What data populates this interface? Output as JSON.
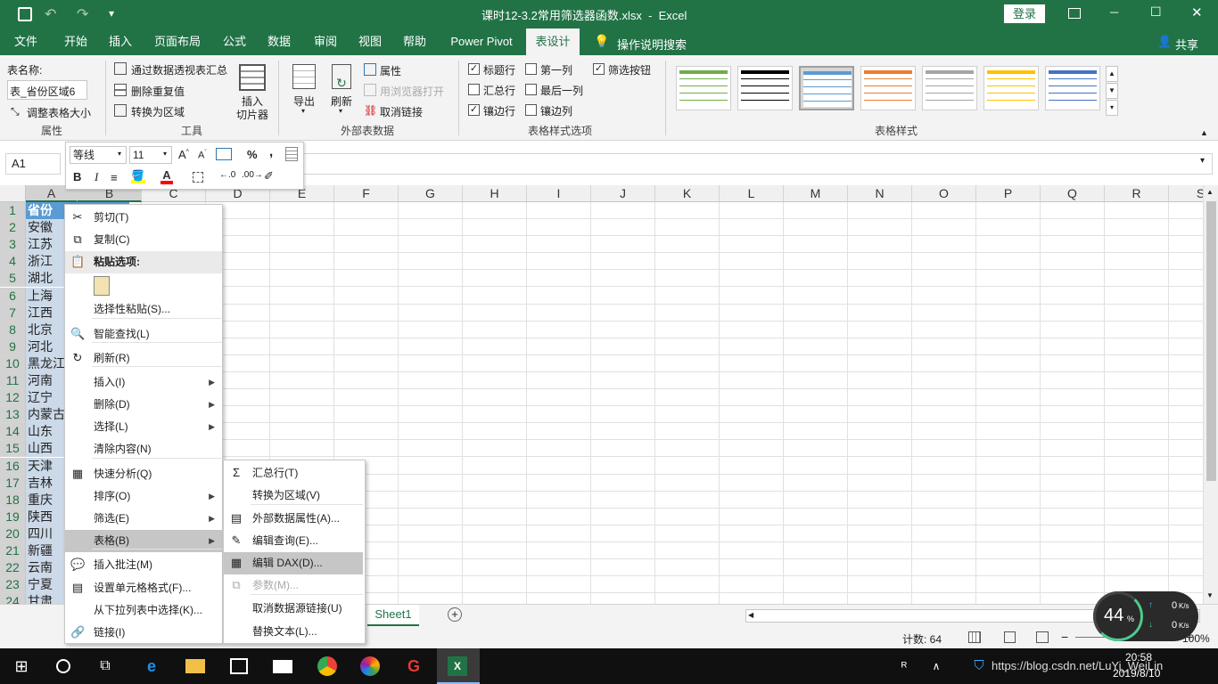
{
  "title": {
    "text": "课时12-3.2常用筛选器函数.xlsx  -  Excel",
    "login": "登录",
    "qat": {
      "save": "save-icon",
      "undo": "undo-icon",
      "redo": "redo-icon",
      "customize": "▾"
    },
    "window_controls": [
      "─",
      "☐",
      "✕"
    ]
  },
  "tabs": [
    "文件",
    "开始",
    "插入",
    "页面布局",
    "公式",
    "数据",
    "审阅",
    "视图",
    "帮助",
    "Power Pivot",
    "表设计"
  ],
  "tell_me": "操作说明搜索",
  "share": "共享",
  "ribbon": {
    "properties": {
      "label": "表名称:",
      "table_name": "表_省份区域6",
      "resize": "调整表格大小",
      "group": "属性"
    },
    "tools": {
      "pivot": "通过数据透视表汇总",
      "remove_dup": "删除重复值",
      "convert": "转换为区域",
      "slicer_line1": "插入",
      "slicer_line2": "切片器",
      "group": "工具"
    },
    "external": {
      "export": "导出",
      "refresh": "刷新",
      "properties": "属性",
      "open_browser": "用浏览器打开",
      "unlink": "取消链接",
      "group": "外部表数据"
    },
    "style_options": {
      "header_row": {
        "label": "标题行",
        "checked": true
      },
      "total_row": {
        "label": "汇总行",
        "checked": false
      },
      "banded_rows": {
        "label": "镶边行",
        "checked": true
      },
      "first_col": {
        "label": "第一列",
        "checked": false
      },
      "last_col": {
        "label": "最后一列",
        "checked": false
      },
      "banded_cols": {
        "label": "镶边列",
        "checked": false
      },
      "filter_btn": {
        "label": "筛选按钮",
        "checked": true
      },
      "group": "表格样式选项"
    },
    "styles": {
      "group": "表格样式",
      "colors": [
        "#70ad47",
        "#000000",
        "#5b9bd5",
        "#ed7d31",
        "#a5a5a5",
        "#ffc000",
        "#4472c4"
      ]
    }
  },
  "namebox": "A1",
  "mini_toolbar": {
    "font": "等线",
    "size": "11",
    "bold": "B",
    "italic": "I",
    "percent": "%",
    "comma": ","
  },
  "columns": [
    "A",
    "B",
    "C",
    "D",
    "E",
    "F",
    "G",
    "H",
    "I",
    "J",
    "K",
    "L",
    "M",
    "N",
    "O",
    "P",
    "Q",
    "R",
    "S"
  ],
  "rows": [
    "1",
    "2",
    "3",
    "4",
    "5",
    "6",
    "7",
    "8",
    "9",
    "10",
    "11",
    "12",
    "13",
    "14",
    "15",
    "16",
    "17",
    "18",
    "19",
    "20",
    "21",
    "22",
    "23",
    "24"
  ],
  "col_a": [
    "省份",
    "安徽",
    "江苏",
    "浙江",
    "湖北",
    "上海",
    "江西",
    "北京",
    "河北",
    "黑龙江",
    "河南",
    "辽宁",
    "内蒙古",
    "山东",
    "山西",
    "天津",
    "吉林",
    "重庆",
    "陕西",
    "四川",
    "新疆",
    "云南",
    "宁夏",
    "甘肃"
  ],
  "context_menu": [
    {
      "label": "剪切(T)",
      "icon": "cut-icon"
    },
    {
      "label": "复制(C)",
      "icon": "copy-icon"
    },
    {
      "label": "粘贴选项:",
      "icon": "paste-icon",
      "header": true
    },
    {
      "label": "选择性粘贴(S)...",
      "icon": ""
    },
    {
      "label": "智能查找(L)",
      "icon": "smart-lookup-icon"
    },
    {
      "label": "刷新(R)",
      "icon": "refresh-icon"
    },
    {
      "label": "插入(I)",
      "sub": true
    },
    {
      "label": "删除(D)",
      "sub": true
    },
    {
      "label": "选择(L)",
      "sub": true
    },
    {
      "label": "清除内容(N)"
    },
    {
      "label": "快速分析(Q)",
      "icon": "quick-analysis-icon"
    },
    {
      "label": "排序(O)",
      "sub": true
    },
    {
      "label": "筛选(E)",
      "sub": true
    },
    {
      "label": "表格(B)",
      "sub": true,
      "highlight": true
    },
    {
      "label": "插入批注(M)",
      "icon": "comment-icon"
    },
    {
      "label": "设置单元格格式(F)...",
      "icon": "format-cells-icon"
    },
    {
      "label": "从下拉列表中选择(K)..."
    },
    {
      "label": "链接(I)",
      "icon": "link-icon"
    }
  ],
  "submenu": [
    {
      "label": "汇总行(T)",
      "icon": "sum-icon"
    },
    {
      "label": "转换为区域(V)"
    },
    {
      "label": "外部数据属性(A)...",
      "icon": "properties-icon"
    },
    {
      "label": "编辑查询(E)...",
      "icon": "edit-query-icon"
    },
    {
      "label": "编辑 DAX(D)...",
      "icon": "dax-icon",
      "highlight": true
    },
    {
      "label": "参数(M)...",
      "icon": "parameters-icon",
      "disabled": true
    },
    {
      "label": "取消数据源链接(U)"
    },
    {
      "label": "替换文本(L)..."
    }
  ],
  "sheet_tab": "Sheet1",
  "status": {
    "count": "计数: 64",
    "zoom": "100%"
  },
  "net_widget": {
    "percent": "44",
    "unit": "%",
    "up": "0",
    "down": "0",
    "speed_unit": "K/s"
  },
  "taskbar": {
    "time": "20:58",
    "date": "2019/8/10",
    "watermark": "https://blog.csdn.net/LuYi_WeiLin"
  }
}
